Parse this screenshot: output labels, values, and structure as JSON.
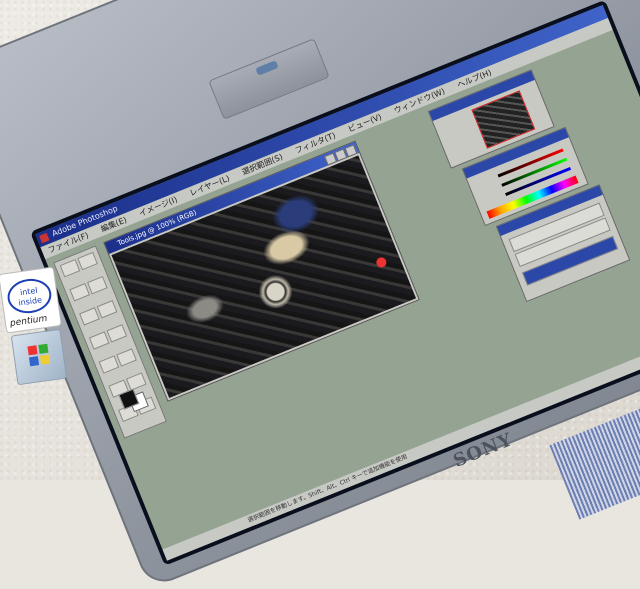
{
  "app": {
    "title": "Adobe Photoshop",
    "menus": [
      "ファイル(F)",
      "編集(E)",
      "イメージ(I)",
      "レイヤー(L)",
      "選択範囲(S)",
      "フィルタ(T)",
      "ビュー(V)",
      "ウィンドウ(W)",
      "ヘルプ(H)"
    ]
  },
  "document": {
    "title": "Tools.jpg @ 100% (RGB)"
  },
  "stickers": {
    "intel_logo": "intel inside",
    "intel_sub": "pentium"
  },
  "brand": "SONY",
  "status": {
    "text": "選択範囲を移動します。Shift、Alt、Ctrl キーで追加機能を使用"
  },
  "icons": {
    "app": "photoshop-icon",
    "foreground_color": "foreground-swatch-icon",
    "background_color": "background-swatch-icon"
  },
  "colors": {
    "titlebar": "#1b2f8a",
    "workspace": "#95a393",
    "bezel": "#9aa0a9"
  }
}
